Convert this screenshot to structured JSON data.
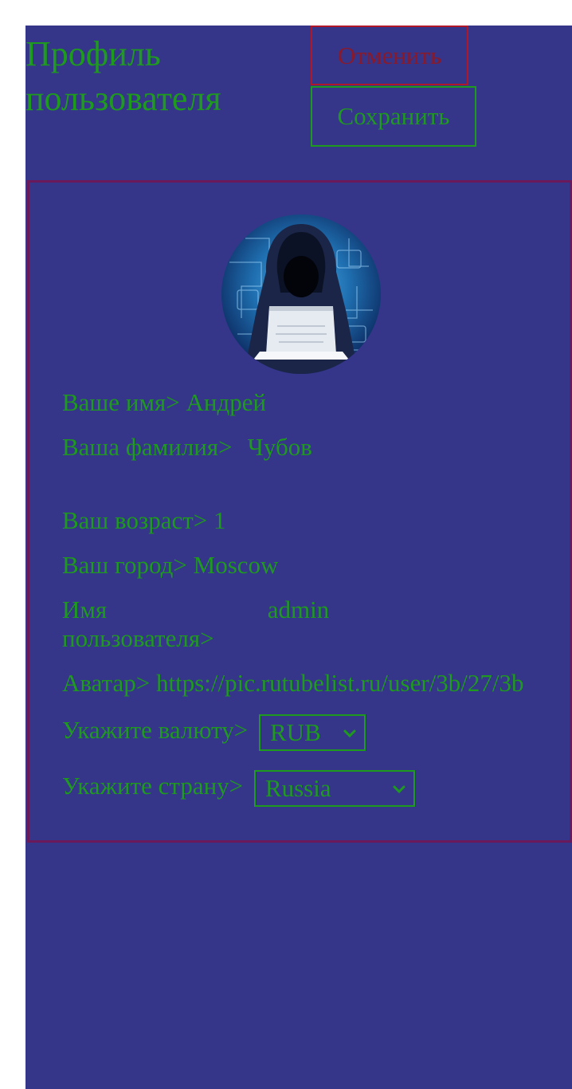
{
  "header": {
    "title": "Профиль пользователя",
    "cancel_label": "Отменить",
    "save_label": "Сохранить"
  },
  "profile": {
    "name_label": "Ваше имя>",
    "name_value": "Андрей",
    "surname_label": "Ваша фамилия>",
    "surname_value": "Чубов",
    "age_label": "Ваш возраст>",
    "age_value": "1",
    "city_label": "Ваш город>",
    "city_value": "Moscow",
    "username_label": "Имя пользователя>",
    "username_value": "admin",
    "avatar_label": "Аватар>",
    "avatar_value": "https://pic.rutubelist.ru/user/3b/27/3b",
    "currency_label": "Укажите валюту>",
    "currency_value": "RUB",
    "country_label": "Укажите страну>",
    "country_value": "Russia"
  },
  "colors": {
    "background": "#35358a",
    "text_accent": "#1e9a1e",
    "cancel": "#b0182a",
    "card_border": "#6a1a5a"
  },
  "icons": {
    "avatar": "hooded-hacker-avatar-icon",
    "select": "chevron-down-icon"
  }
}
